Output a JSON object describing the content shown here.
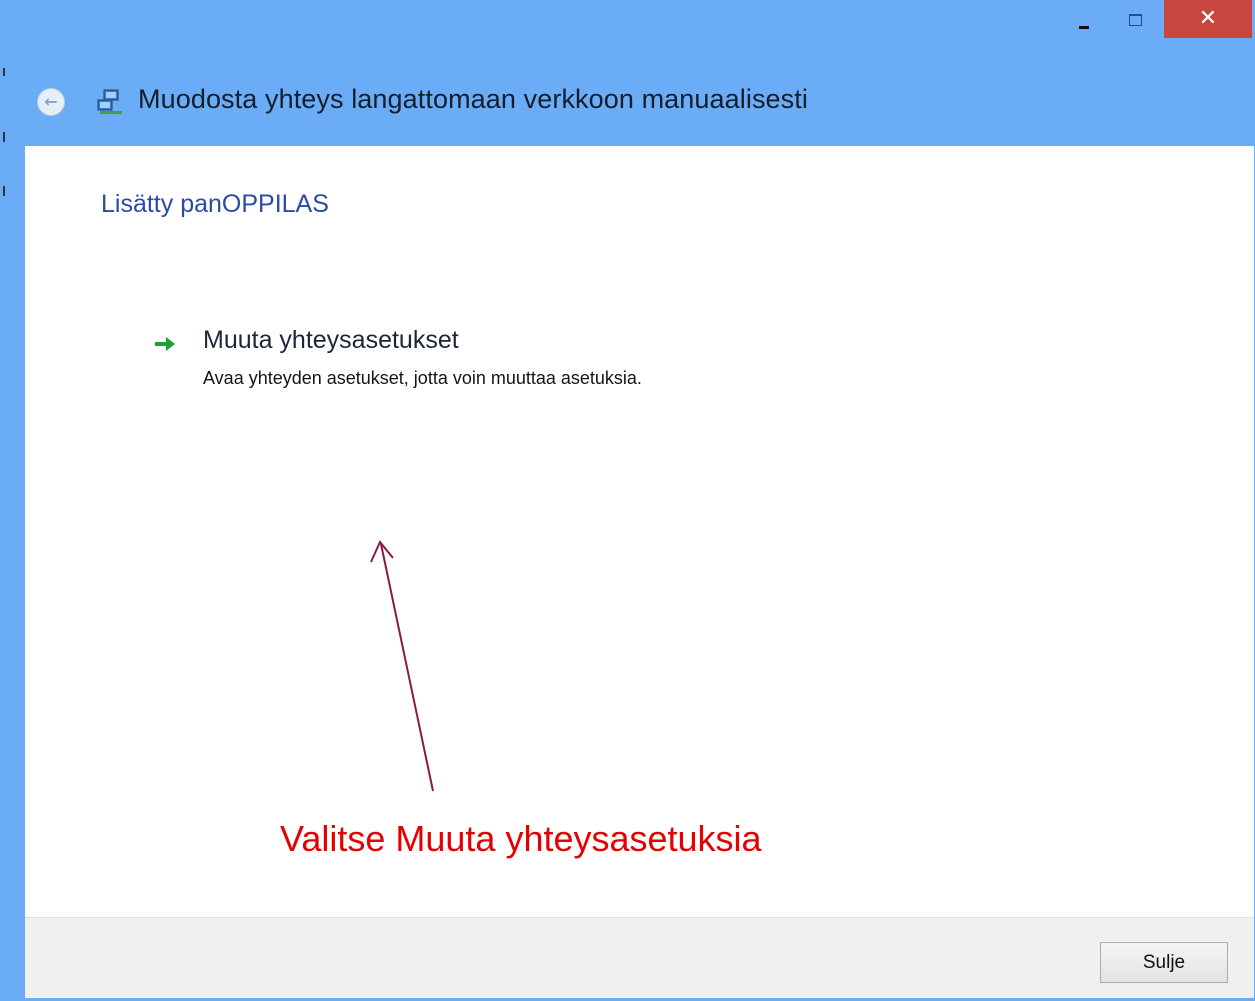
{
  "window": {
    "title": "Muodosta yhteys langattomaan verkkoon manuaalisesti",
    "frame_color": "#6aacf6",
    "close_color": "#c8463e"
  },
  "titlebar": {
    "minimize_icon": "minimize-icon",
    "maximize_icon": "maximize-icon",
    "close_glyph": "✕"
  },
  "nav": {
    "back_icon": "back-arrow-icon",
    "app_icon": "network-icon"
  },
  "main": {
    "heading": "Lisätty panOPPILAS",
    "option": {
      "icon": "green-arrow-icon",
      "title": "Muuta yhteysasetukset",
      "description": "Avaa yhteyden asetukset, jotta voin muuttaa asetuksia."
    }
  },
  "annotation": {
    "text": "Valitse Muuta yhteysasetuksia",
    "color": "#e60000",
    "arrow_color": "#8b1a4a"
  },
  "footer": {
    "close_label": "Sulje"
  }
}
